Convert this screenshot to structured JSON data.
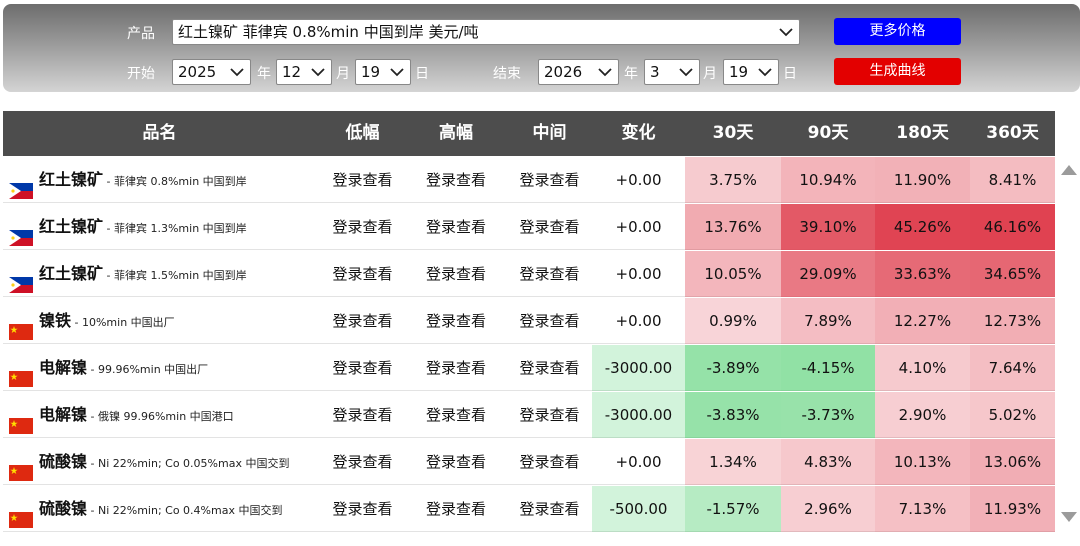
{
  "filter": {
    "product_label": "产品",
    "product_value": "红土镍矿 菲律宾 0.8%min 中国到岸 美元/吨",
    "more_prices_label": "更多价格",
    "start_label": "开始",
    "start_year": "2025",
    "start_month": "12",
    "start_day": "19",
    "year_unit": "年",
    "month_unit": "月",
    "day_unit": "日",
    "end_label": "结束",
    "end_year": "2026",
    "end_month": "3",
    "end_day": "19",
    "generate_curve_label": "生成曲线",
    "colors": {
      "more_prices": "#0000ff",
      "generate_curve": "#e30000"
    }
  },
  "table": {
    "headers": [
      "品名",
      "低幅",
      "高幅",
      "中间",
      "变化",
      "30天",
      "90天",
      "180天",
      "360天"
    ],
    "rows": [
      {
        "flag": "philippines-flag",
        "name": "红土镍矿",
        "desc": " - 菲律宾 0.8%min 中国到岸",
        "low": "登录查看",
        "high": "登录查看",
        "mid": "登录查看",
        "change": "+0.00",
        "d30": "3.75%",
        "d90": "10.94%",
        "d180": "11.90%",
        "d360": "8.41%"
      },
      {
        "flag": "philippines-flag",
        "name": "红土镍矿",
        "desc": " - 菲律宾 1.3%min 中国到岸",
        "low": "登录查看",
        "high": "登录查看",
        "mid": "登录查看",
        "change": "+0.00",
        "d30": "13.76%",
        "d90": "39.10%",
        "d180": "45.26%",
        "d360": "46.16%"
      },
      {
        "flag": "philippines-flag",
        "name": "红土镍矿",
        "desc": " - 菲律宾 1.5%min 中国到岸",
        "low": "登录查看",
        "high": "登录查看",
        "mid": "登录查看",
        "change": "+0.00",
        "d30": "10.05%",
        "d90": "29.09%",
        "d180": "33.63%",
        "d360": "34.65%"
      },
      {
        "flag": "china-flag",
        "name": "镍铁",
        "desc": " - 10%min 中国出厂",
        "low": "登录查看",
        "high": "登录查看",
        "mid": "登录查看",
        "change": "+0.00",
        "d30": "0.99%",
        "d90": "7.89%",
        "d180": "12.27%",
        "d360": "12.73%"
      },
      {
        "flag": "china-flag",
        "name": "电解镍",
        "desc": " - 99.96%min 中国出厂",
        "low": "登录查看",
        "high": "登录查看",
        "mid": "登录查看",
        "change": "-3000.00",
        "d30": "-3.89%",
        "d90": "-4.15%",
        "d180": "4.10%",
        "d360": "7.64%"
      },
      {
        "flag": "china-flag",
        "name": "电解镍",
        "desc": " - 俄镍 99.96%min 中国港口",
        "low": "登录查看",
        "high": "登录查看",
        "mid": "登录查看",
        "change": "-3000.00",
        "d30": "-3.83%",
        "d90": "-3.73%",
        "d180": "2.90%",
        "d360": "5.02%"
      },
      {
        "flag": "china-flag",
        "name": "硫酸镍",
        "desc": " - Ni 22%min; Co 0.05%max 中国交到",
        "low": "登录查看",
        "high": "登录查看",
        "mid": "登录查看",
        "change": "+0.00",
        "d30": "1.34%",
        "d90": "4.83%",
        "d180": "10.13%",
        "d360": "13.06%"
      },
      {
        "flag": "china-flag",
        "name": "硫酸镍",
        "desc": " - Ni 22%min; Co 0.4%max 中国交到",
        "low": "登录查看",
        "high": "登录查看",
        "mid": "登录查看",
        "change": "-500.00",
        "d30": "-1.57%",
        "d90": "2.96%",
        "d180": "7.13%",
        "d360": "11.93%"
      }
    ]
  }
}
